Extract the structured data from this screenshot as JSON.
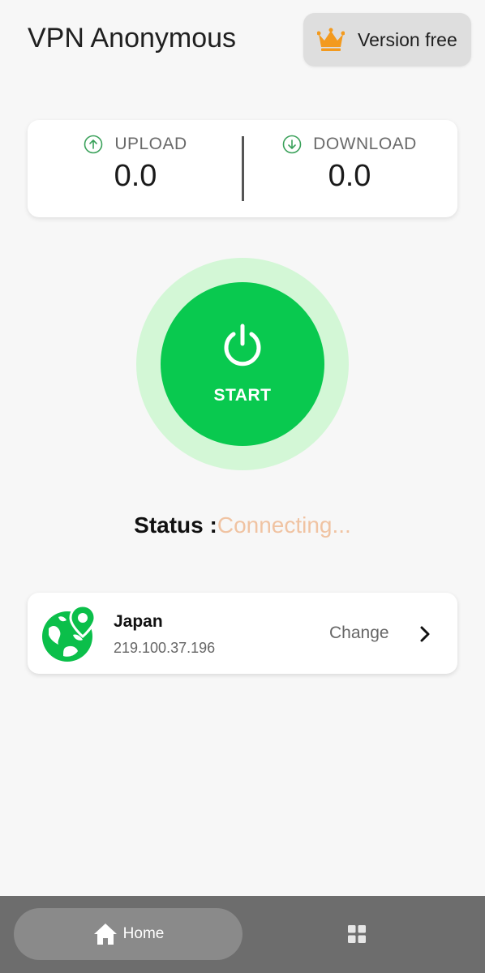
{
  "header": {
    "title": "VPN Anonymous",
    "version_button": "Version free"
  },
  "stats": {
    "upload_label": "UPLOAD",
    "upload_value": "0.0",
    "download_label": "DOWNLOAD",
    "download_value": "0.0"
  },
  "power": {
    "label": "START"
  },
  "status": {
    "label": "Status :",
    "value": "Connecting..."
  },
  "server": {
    "country": "Japan",
    "ip": "219.100.37.196",
    "change_label": "Change"
  },
  "nav": {
    "home_label": "Home"
  },
  "colors": {
    "accent_green": "#09c94f",
    "ring_green": "#d3f7d6",
    "status_color": "#f0c3a2",
    "crown_orange": "#f39a1e"
  },
  "icons": {
    "crown": "crown-icon",
    "upload": "upload-arrow-icon",
    "download": "download-arrow-icon",
    "power": "power-icon",
    "globe": "globe-location-icon",
    "chevron": "chevron-right-icon",
    "home": "home-icon",
    "grid": "grid-icon"
  }
}
